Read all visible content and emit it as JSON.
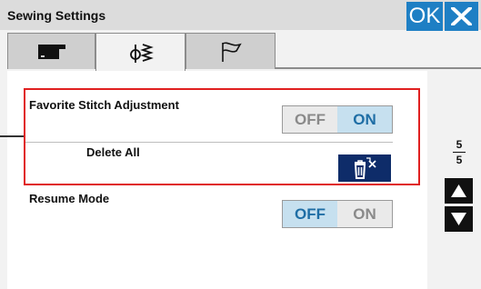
{
  "window": {
    "title": "Sewing Settings"
  },
  "header": {
    "ok_label": "OK"
  },
  "tabs": [
    {
      "icon": "sewing-machine-icon"
    },
    {
      "icon": "stitch-icon"
    },
    {
      "icon": "flag-icon"
    }
  ],
  "settings": {
    "favorite_stitch": {
      "label": "Favorite Stitch Adjustment",
      "off_label": "OFF",
      "on_label": "ON",
      "selected": "ON"
    },
    "delete_all": {
      "label": "Delete All",
      "icon": "trash-icon"
    },
    "resume_mode": {
      "label": "Resume Mode",
      "off_label": "OFF",
      "on_label": "ON",
      "selected": "OFF"
    }
  },
  "pager": {
    "current": "5",
    "total": "5"
  },
  "colors": {
    "accent": "#1e7fc4",
    "selected_bg": "#c6e0ef",
    "selected_text": "#1f6ea5",
    "highlight": "#e02020",
    "delete_button": "#0e2c69"
  }
}
